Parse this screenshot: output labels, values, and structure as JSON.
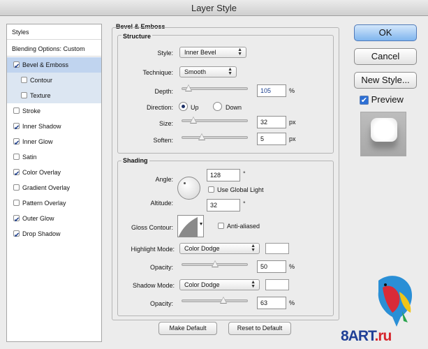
{
  "window": {
    "title": "Layer Style"
  },
  "sidebar": {
    "header": "Styles",
    "blending": "Blending Options: Custom",
    "items": [
      {
        "label": "Bevel & Emboss",
        "checked": true,
        "state": "selected"
      },
      {
        "label": "Contour",
        "checked": false,
        "state": "sub"
      },
      {
        "label": "Texture",
        "checked": false,
        "state": "sub"
      },
      {
        "label": "Stroke",
        "checked": false
      },
      {
        "label": "Inner Shadow",
        "checked": true
      },
      {
        "label": "Inner Glow",
        "checked": true
      },
      {
        "label": "Satin",
        "checked": false
      },
      {
        "label": "Color Overlay",
        "checked": true
      },
      {
        "label": "Gradient Overlay",
        "checked": false
      },
      {
        "label": "Pattern Overlay",
        "checked": false
      },
      {
        "label": "Outer Glow",
        "checked": true
      },
      {
        "label": "Drop Shadow",
        "checked": true
      }
    ]
  },
  "panel": {
    "title": "Bevel & Emboss",
    "structure": {
      "title": "Structure",
      "style_label": "Style:",
      "style_value": "Inner Bevel",
      "technique_label": "Technique:",
      "technique_value": "Smooth",
      "depth_label": "Depth:",
      "depth_value": "105",
      "depth_unit": "%",
      "depth_slider": 0.1,
      "direction_label": "Direction:",
      "dir_up": "Up",
      "dir_down": "Down",
      "size_label": "Size:",
      "size_value": "32",
      "size_unit": "px",
      "size_slider": 0.17,
      "soften_label": "Soften:",
      "soften_value": "5",
      "soften_unit": "px",
      "soften_slider": 0.3
    },
    "shading": {
      "title": "Shading",
      "angle_label": "Angle:",
      "angle_value": "128",
      "angle_unit": "°",
      "global_light": "Use Global Light",
      "altitude_label": "Altitude:",
      "altitude_value": "32",
      "altitude_unit": "°",
      "gloss_label": "Gloss Contour:",
      "anti_aliased": "Anti-aliased",
      "highlight_label": "Highlight Mode:",
      "highlight_value": "Color Dodge",
      "h_opacity_label": "Opacity:",
      "h_opacity_value": "50",
      "h_opacity_unit": "%",
      "h_opacity_slider": 0.5,
      "shadow_label": "Shadow Mode:",
      "shadow_value": "Color Dodge",
      "s_opacity_label": "Opacity:",
      "s_opacity_value": "63",
      "s_opacity_unit": "%",
      "s_opacity_slider": 0.63
    },
    "make_default": "Make Default",
    "reset_default": "Reset to Default"
  },
  "buttons": {
    "ok": "OK",
    "cancel": "Cancel",
    "new_style": "New Style...",
    "preview": "Preview"
  },
  "watermark": {
    "main": "8ART",
    "suffix": ".ru"
  }
}
